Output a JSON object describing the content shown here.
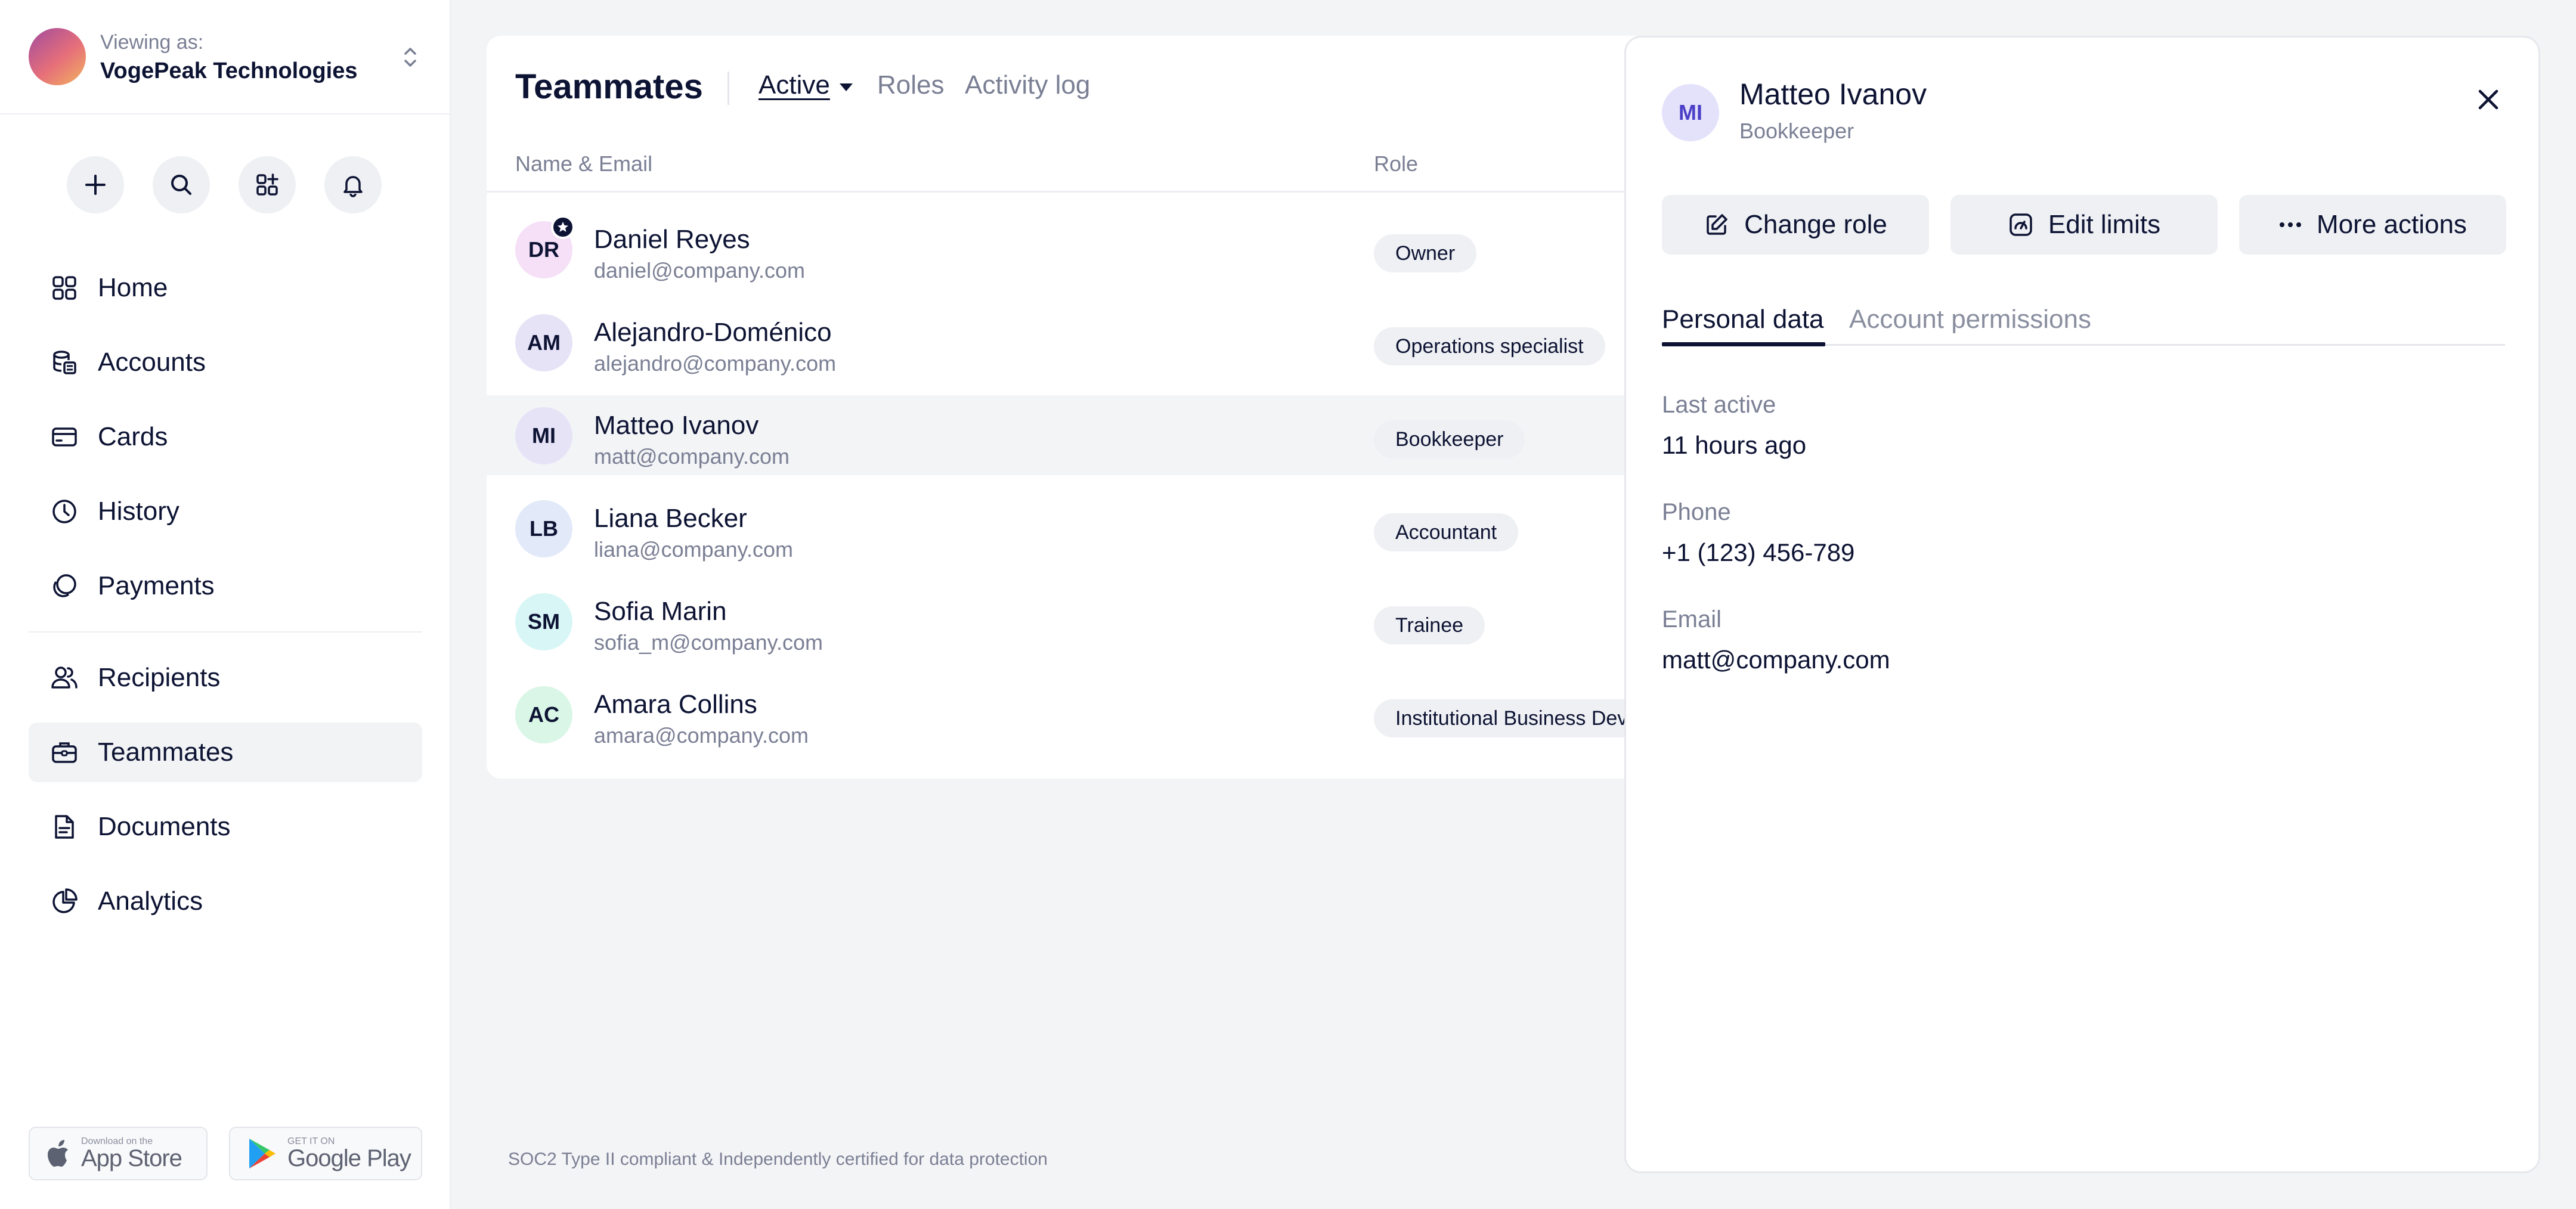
{
  "sidebar": {
    "org": {
      "label": "Viewing as:",
      "name": "VogePeak Technologies"
    },
    "quick_actions": [
      "add",
      "search",
      "apps",
      "notifications"
    ],
    "nav": [
      {
        "label": "Home",
        "icon": "home-icon"
      },
      {
        "label": "Accounts",
        "icon": "accounts-icon"
      },
      {
        "label": "Cards",
        "icon": "card-icon"
      },
      {
        "label": "History",
        "icon": "clock-icon"
      },
      {
        "label": "Payments",
        "icon": "payments-icon"
      },
      {
        "label": "Recipients",
        "icon": "users-icon"
      },
      {
        "label": "Teammates",
        "icon": "briefcase-icon",
        "active": true
      },
      {
        "label": "Documents",
        "icon": "document-icon"
      },
      {
        "label": "Analytics",
        "icon": "pie-chart-icon"
      }
    ],
    "stores": {
      "apple": {
        "small": "Download on the",
        "big": "App Store"
      },
      "google": {
        "small": "GET IT ON",
        "big": "Google Play"
      }
    }
  },
  "main": {
    "title": "Teammates",
    "tabs": [
      {
        "label": "Active",
        "active": true
      },
      {
        "label": "Roles"
      },
      {
        "label": "Activity log"
      }
    ],
    "columns": {
      "name_email": "Name & Email",
      "role": "Role"
    },
    "members": [
      {
        "initials": "DR",
        "name": "Daniel Reyes",
        "email": "daniel@company.com",
        "role": "Owner",
        "avatar_color": "#f5e0f7",
        "owner": true
      },
      {
        "initials": "AM",
        "name": "Alejandro-Doménico",
        "email": "alejandro@company.com",
        "role": "Operations specialist",
        "avatar_color": "#e6e3f7"
      },
      {
        "initials": "MI",
        "name": "Matteo Ivanov",
        "email": "matt@company.com",
        "role": "Bookkeeper",
        "avatar_color": "#e6e3f7",
        "selected": true
      },
      {
        "initials": "LB",
        "name": "Liana Becker",
        "email": "liana@company.com",
        "role": "Accountant",
        "avatar_color": "#e2e9f9"
      },
      {
        "initials": "SM",
        "name": "Sofia Marin",
        "email": "sofia_m@company.com",
        "role": "Trainee",
        "avatar_color": "#d8f6f6"
      },
      {
        "initials": "AC",
        "name": "Amara Collins",
        "email": "amara@company.com",
        "role": "Institutional Business Development",
        "avatar_color": "#d9f6e6"
      }
    ],
    "footer": "SOC2 Type II compliant & Independently certified for data protection"
  },
  "panel": {
    "initials": "MI",
    "name": "Matteo Ivanov",
    "role": "Bookkeeper",
    "actions": {
      "change_role": "Change role",
      "edit_limits": "Edit limits",
      "more_actions": "More actions"
    },
    "tabs": {
      "personal": "Personal data",
      "permissions": "Account permissions"
    },
    "fields": [
      {
        "label": "Last active",
        "value": "11 hours ago"
      },
      {
        "label": "Phone",
        "value": "+1 (123) 456-789"
      },
      {
        "label": "Email",
        "value": "matt@company.com"
      }
    ]
  },
  "colors": {
    "text": "#0d1333",
    "muted": "#7a7f94",
    "pill": "#eef0f3",
    "panel_avatar": "#4a3fc6"
  }
}
